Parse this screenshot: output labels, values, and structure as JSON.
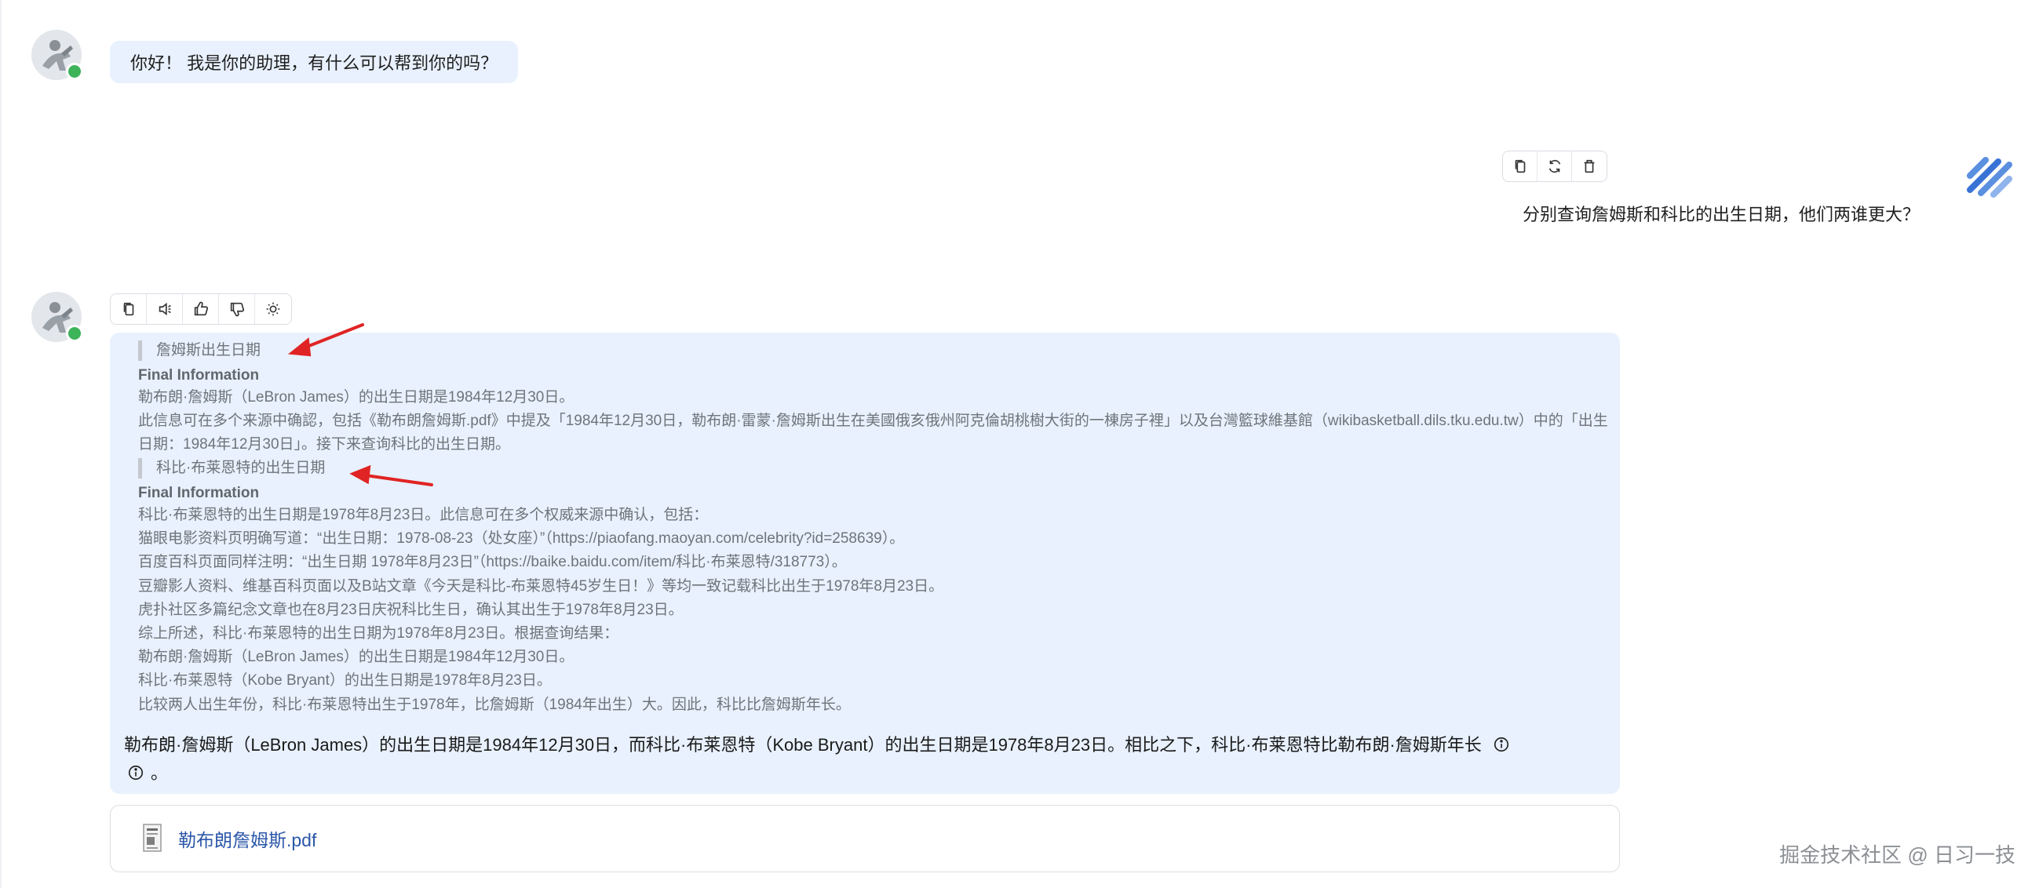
{
  "greeting": {
    "text": "你好！ 我是你的助理，有什么可以帮到你的吗？"
  },
  "user_message": {
    "text": "分别查询詹姆斯和科比的出生日期，他们两谁更大？",
    "toolbar": [
      "copy-icon",
      "refresh-icon",
      "trash-icon"
    ]
  },
  "assistant": {
    "toolbar": [
      "copy-icon",
      "speaker-icon",
      "thumbs-up-icon",
      "thumbs-down-icon",
      "lightbulb-icon"
    ],
    "step1": {
      "title": "詹姆斯出生日期",
      "heading": "Final Information",
      "lines": [
        "勒布朗·詹姆斯（LeBron James）的出生日期是1984年12月30日。",
        "此信息可在多个来源中确認，包括《勒布朗詹姆斯.pdf》中提及「1984年12月30日，勒布朗·雷蒙·詹姆斯出生在美國俄亥俄州阿克倫胡桃樹大街的一棟房子裡」以及台灣籃球維基館（wikibasketball.dils.tku.edu.tw）中的「出生日期：1984年12月30日」。接下来查询科比的出生日期。"
      ]
    },
    "step2": {
      "title": "科比·布莱恩特的出生日期",
      "heading": "Final Information",
      "lines": [
        "科比·布莱恩特的出生日期是1978年8月23日。此信息可在多个权威来源中确认，包括：",
        "猫眼电影资料页明确写道：“出生日期：1978-08-23（处女座）”（https://piaofang.maoyan.com/celebrity?id=258639）。",
        "百度百科页面同样注明：“出生日期 1978年8月23日”（https://baike.baidu.com/item/科比·布莱恩特/318773）。",
        "豆瓣影人资料、维基百科页面以及B站文章《今天是科比-布莱恩特45岁生日！》等均一致记载科比出生于1978年8月23日。",
        "虎扑社区多篇纪念文章也在8月23日庆祝科比生日，确认其出生于1978年8月23日。",
        "综上所述，科比·布莱恩特的出生日期为1978年8月23日。根据查询结果：",
        "勒布朗·詹姆斯（LeBron James）的出生日期是1984年12月30日。",
        "科比·布莱恩特（Kobe Bryant）的出生日期是1978年8月23日。",
        "比较两人出生年份，科比·布莱恩特出生于1978年，比詹姆斯（1984年出生）大。因此，科比比詹姆斯年长。"
      ]
    },
    "summary": "勒布朗·詹姆斯（LeBron James）的出生日期是1984年12月30日，而科比·布莱恩特（Kobe Bryant）的出生日期是1978年8月23日。相比之下，科比·布莱恩特比勒布朗·詹姆斯年长",
    "summary_end": "。"
  },
  "attachment": {
    "file_name": "勒布朗詹姆斯.pdf"
  },
  "watermark": "掘金技术社区 @ 日习一技",
  "colors": {
    "bubble": "#e8f1fd",
    "link": "#2b57a8",
    "arrow": "#e02424",
    "online": "#3db35a"
  }
}
